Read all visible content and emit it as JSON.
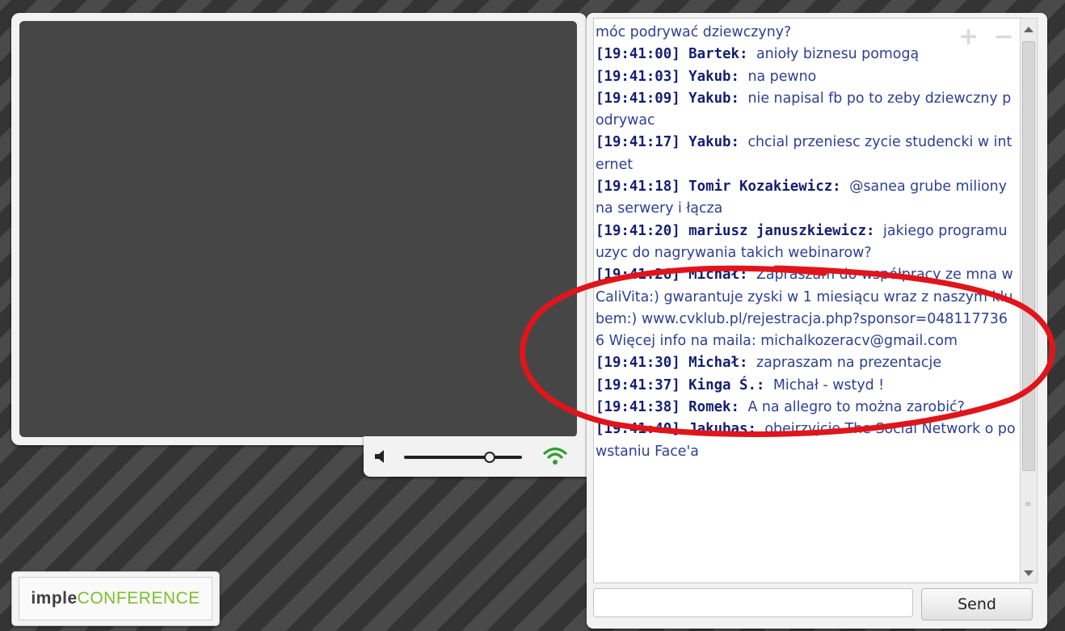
{
  "chat": {
    "messages": [
      {
        "time": "",
        "author": "",
        "text": "móc podrywać dziewczyny?"
      },
      {
        "time": "[19:41:00]",
        "author": "Bartek:",
        "text": "anioły biznesu pomogą"
      },
      {
        "time": "[19:41:03]",
        "author": "Yakub:",
        "text": "na pewno"
      },
      {
        "time": "[19:41:09]",
        "author": "Yakub:",
        "text": "nie napisal fb po to zeby dziewczny podrywac"
      },
      {
        "time": "[19:41:17]",
        "author": "Yakub:",
        "text": "chcial przeniesc zycie studencki w internet"
      },
      {
        "time": "[19:41:18]",
        "author": "Tomir Kozakiewicz:",
        "text": "@sanea grube miliony na serwery i łącza"
      },
      {
        "time": "[19:41:20]",
        "author": "mariusz januszkiewicz:",
        "text": "jakiego programu uzyc do nagrywania takich webinarow?"
      },
      {
        "time": "[19:41:26]",
        "author": "Michał:",
        "text": "Zapraszam do współpracy ze mna w CaliVita:) gwarantuje zyski w 1 miesiącu wraz z naszym klubem:) www.cvklub.pl/rejestracja.php?sponsor=0481177366 Więcej info na maila: michalkozeracv@gmail.com"
      },
      {
        "time": "[19:41:30]",
        "author": "Michał:",
        "text": "zapraszam na prezentacje"
      },
      {
        "time": "[19:41:37]",
        "author": "Kinga Ś.:",
        "text": "Michał - wstyd !"
      },
      {
        "time": "[19:41:38]",
        "author": "Romek:",
        "text": "A na allegro to można zarobić?"
      },
      {
        "time": "[19:41:40]",
        "author": "Jakubas:",
        "text": "obejrzyjcie The Social Network o powstaniu Face'a"
      }
    ],
    "zoom_controls": "+ −",
    "input_value": "",
    "send_label": "Send"
  },
  "audio": {
    "volume_level": 0.72,
    "speaker_icon": "speaker-icon",
    "signal_icon": "wifi-signal-icon",
    "signal_color": "#2e9e2e"
  },
  "logo": {
    "part1": "imple",
    "part2": "CONFERENCE",
    "part2_color": "#7cbf2e"
  },
  "annotation": {
    "color": "#e0151b",
    "shape": "hand-drawn red ellipse around Michał's spam message"
  }
}
